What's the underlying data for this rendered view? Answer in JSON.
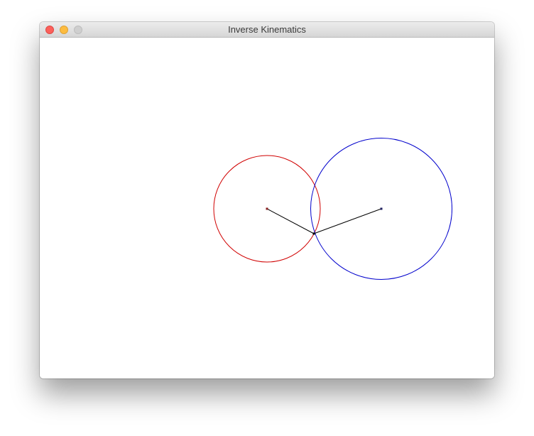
{
  "window": {
    "title": "Inverse Kinematics"
  },
  "icons": {
    "close": "close-icon",
    "minimize": "minimize-icon",
    "zoom": "zoom-icon"
  },
  "colors": {
    "close": "#fc605b",
    "minimize": "#fdbc40",
    "zoom": "#cfcfcf",
    "circle_left": "#d00000",
    "circle_right": "#0000cc",
    "arm": "#000000"
  }
}
